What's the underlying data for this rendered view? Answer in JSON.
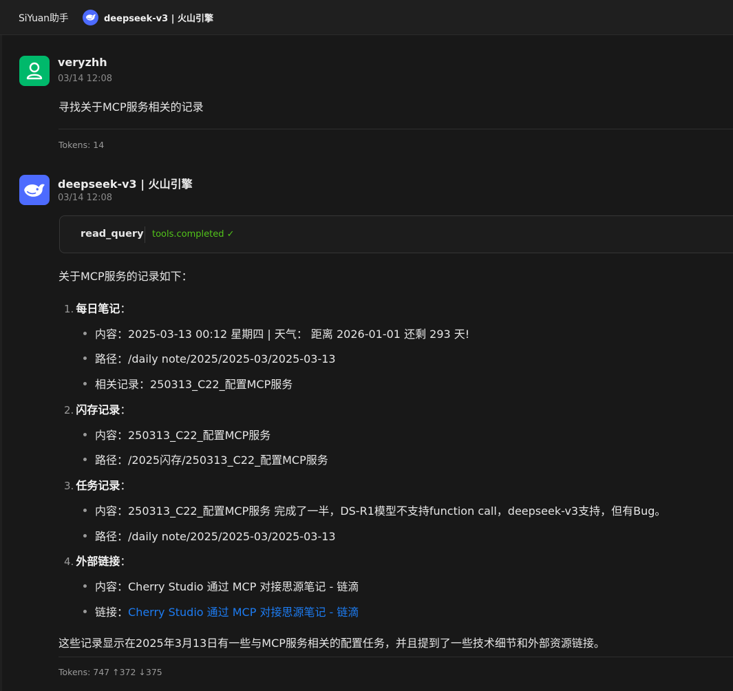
{
  "topbar": {
    "app_title": "SiYuan助手",
    "model_label": "deepseek-v3 | 火山引擎",
    "icons": [
      "deepseek-whale-icon"
    ]
  },
  "messages": {
    "user": {
      "sender": "veryzhh",
      "time": "03/14 12:08",
      "text": "寻找关于MCP服务相关的记录",
      "tokens": "Tokens: 14",
      "avatar_icon": "user-icon",
      "avatar_color": "#00b96b"
    },
    "bot": {
      "sender": "deepseek-v3 | 火山引擎",
      "time": "03/14 12:08",
      "avatar_icon": "deepseek-whale-icon",
      "avatar_color": "#4d6bfe",
      "tool": {
        "name": "read_query",
        "status": "tools.completed ✓",
        "status_color": "#52c41a"
      },
      "intro": "关于MCP服务的记录如下：",
      "sections": [
        {
          "num": "1.",
          "title": "每日笔记",
          "colon": "：",
          "items": [
            {
              "text": "内容：2025-03-13 00:12 星期四 | 天气： 距离 2026-01-01 还剩 293 天!"
            },
            {
              "text": "路径：/daily note/2025/2025-03/2025-03-13"
            },
            {
              "text": "相关记录：250313_C22_配置MCP服务"
            }
          ]
        },
        {
          "num": "2.",
          "title": "闪存记录",
          "colon": "：",
          "items": [
            {
              "text": "内容：250313_C22_配置MCP服务"
            },
            {
              "text": "路径：/2025闪存/250313_C22_配置MCP服务"
            }
          ]
        },
        {
          "num": "3.",
          "title": "任务记录",
          "colon": "：",
          "items": [
            {
              "text": "内容：250313_C22_配置MCP服务 完成了一半，DS-R1模型不支持function call，deepseek-v3支持，但有Bug。"
            },
            {
              "text": "路径：/daily note/2025/2025-03/2025-03-13"
            }
          ]
        },
        {
          "num": "4.",
          "title": "外部链接",
          "colon": "：",
          "items": [
            {
              "text": "内容：Cherry Studio 通过 MCP 对接思源笔记 - 链滴"
            },
            {
              "label": "链接：",
              "link": "Cherry Studio 通过 MCP 对接思源笔记 - 链滴",
              "link_color": "#1d7cf2"
            }
          ]
        }
      ],
      "summary": "这些记录显示在2025年3月13日有一些与MCP服务相关的配置任务，并且提到了一些技术细节和外部资源链接。",
      "tokens": "Tokens: 747 ↑372 ↓375"
    }
  }
}
